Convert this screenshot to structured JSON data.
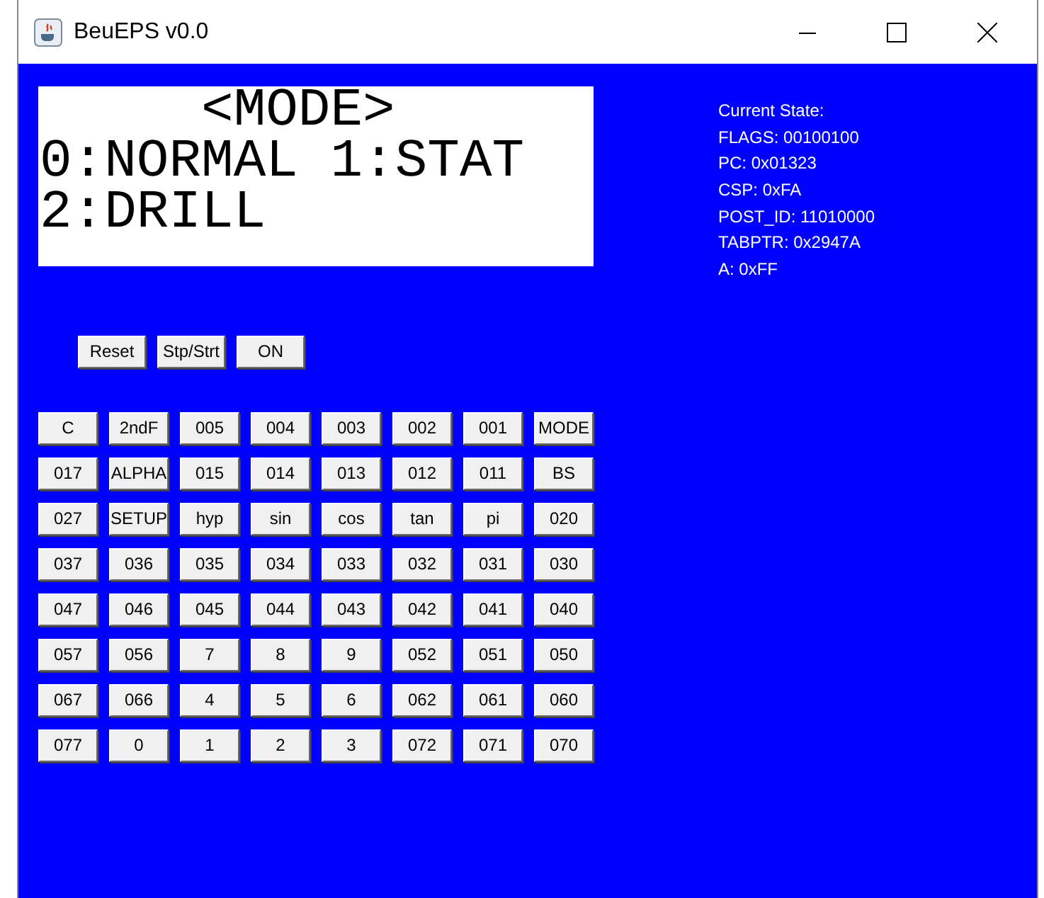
{
  "window": {
    "title": "BeuEPS v0.0"
  },
  "lcd": {
    "lines": [
      "     <MODE>",
      "0:NORMAL 1:STAT",
      "2:DRILL"
    ]
  },
  "state": {
    "lines": [
      "Current State:",
      "FLAGS: 00100100",
      "PC: 0x01323",
      "CSP: 0xFA",
      "POST_ID: 11010000",
      "TABPTR: 0x2947A",
      "A: 0xFF"
    ]
  },
  "controls": [
    "Reset",
    "Stp/Strt",
    "ON"
  ],
  "keypad": [
    [
      "C",
      "2ndF",
      "005",
      "004",
      "003",
      "002",
      "001",
      "MODE"
    ],
    [
      "017",
      "ALPHA",
      "015",
      "014",
      "013",
      "012",
      "011",
      "BS"
    ],
    [
      "027",
      "SETUP",
      "hyp",
      "sin",
      "cos",
      "tan",
      "pi",
      "020"
    ],
    [
      "037",
      "036",
      "035",
      "034",
      "033",
      "032",
      "031",
      "030"
    ],
    [
      "047",
      "046",
      "045",
      "044",
      "043",
      "042",
      "041",
      "040"
    ],
    [
      "057",
      "056",
      "7",
      "8",
      "9",
      "052",
      "051",
      "050"
    ],
    [
      "067",
      "066",
      "4",
      "5",
      "6",
      "062",
      "061",
      "060"
    ],
    [
      "077",
      "0",
      "1",
      "2",
      "3",
      "072",
      "071",
      "070"
    ]
  ]
}
